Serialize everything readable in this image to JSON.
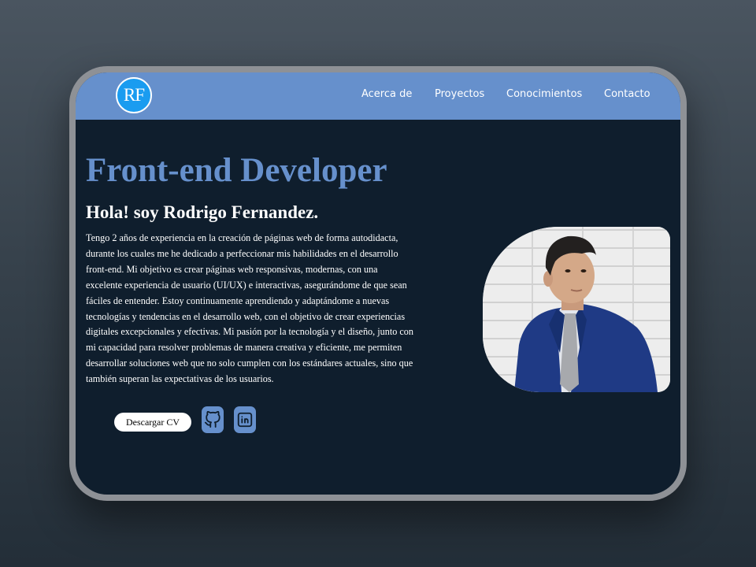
{
  "logo": {
    "text": "RF"
  },
  "nav": {
    "items": [
      {
        "label": "Acerca de"
      },
      {
        "label": "Proyectos"
      },
      {
        "label": "Conocimientos"
      },
      {
        "label": "Contacto"
      }
    ]
  },
  "hero": {
    "title": "Front-end Developer",
    "greeting": "Hola! soy Rodrigo Fernandez.",
    "bio": "Tengo 2 años de experiencia en la creación de páginas web de forma autodidacta, durante los cuales me he dedicado a perfeccionar mis habilidades en el desarrollo front-end. Mi objetivo es crear páginas web responsivas, modernas, con una excelente experiencia de usuario (UI/UX) e interactivas, asegurándome de que sean fáciles de entender. Estoy continuamente aprendiendo y adaptándome a nuevas tecnologías y tendencias en el desarrollo web, con el objetivo de crear experiencias digitales excepcionales y efectivas. Mi pasión por la tecnología y el diseño, junto con mi capacidad para resolver problemas de manera creativa y eficiente, me permiten desarrollar soluciones web que no solo cumplen con los estándares actuales, sino que también superan las expectativas de los usuarios."
  },
  "actions": {
    "download_cv_label": "Descargar CV",
    "social_icons": [
      "github-icon",
      "linkedin-icon"
    ]
  },
  "colors": {
    "accent": "#6690cc",
    "background": "#0f1e2d",
    "logo_circle": "#1a9cf0",
    "frame": "#8e9196"
  }
}
